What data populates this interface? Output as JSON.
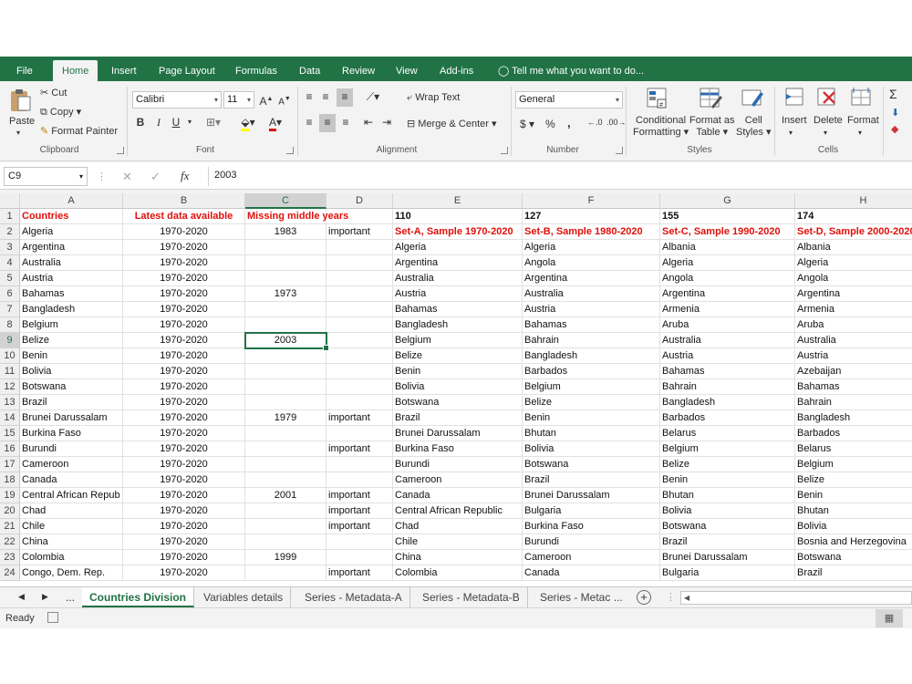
{
  "ribbon_tabs": [
    "File",
    "Home",
    "Insert",
    "Page Layout",
    "Formulas",
    "Data",
    "Review",
    "View",
    "Add-ins",
    "Tell me what you want to do..."
  ],
  "clipboard": {
    "paste": "Paste",
    "cut": "Cut",
    "copy": "Copy",
    "format_painter": "Format Painter",
    "label": "Clipboard"
  },
  "font": {
    "name": "Calibri",
    "size": "11",
    "bold": "B",
    "italic": "I",
    "underline": "U",
    "label": "Font"
  },
  "alignment": {
    "wrap_text": "Wrap Text",
    "merge_center": "Merge & Center",
    "label": "Alignment"
  },
  "number": {
    "format": "General",
    "currency": "$",
    "percent": "%",
    "comma": ",",
    "label": "Number"
  },
  "styles": {
    "conditional": "Conditional",
    "conditional2": "Formatting",
    "format_as": "Format as",
    "table": "Table",
    "cell": "Cell",
    "styles_btn": "Styles",
    "label": "Styles"
  },
  "cells": {
    "insert": "Insert",
    "delete": "Delete",
    "format": "Format",
    "label": "Cells"
  },
  "formula_bar": {
    "name_box": "C9",
    "value": "2003"
  },
  "columns": [
    "A",
    "B",
    "C",
    "D",
    "E",
    "F",
    "G",
    "H"
  ],
  "rows": [
    [
      "Countries",
      "Latest data available",
      "Missing middle years",
      "",
      "110",
      "127",
      "155",
      "174"
    ],
    [
      "Algeria",
      "1970-2020",
      "1983",
      "important",
      "Set-A, Sample 1970-2020",
      "Set-B, Sample 1980-2020",
      "Set-C, Sample 1990-2020",
      "Set-D, Sample 2000-2020"
    ],
    [
      "Argentina",
      "1970-2020",
      "",
      "",
      "Algeria",
      "Algeria",
      "Albania",
      "Albania"
    ],
    [
      "Australia",
      "1970-2020",
      "",
      "",
      "Argentina",
      "Angola",
      "Algeria",
      "Algeria"
    ],
    [
      "Austria",
      "1970-2020",
      "",
      "",
      "Australia",
      "Argentina",
      "Angola",
      "Angola"
    ],
    [
      "Bahamas",
      "1970-2020",
      "1973",
      "",
      "Austria",
      "Australia",
      "Argentina",
      "Argentina"
    ],
    [
      "Bangladesh",
      "1970-2020",
      "",
      "",
      "Bahamas",
      "Austria",
      "Armenia",
      "Armenia"
    ],
    [
      "Belgium",
      "1970-2020",
      "",
      "",
      "Bangladesh",
      "Bahamas",
      "Aruba",
      "Aruba"
    ],
    [
      "Belize",
      "1970-2020",
      "2003",
      "",
      "Belgium",
      "Bahrain",
      "Australia",
      "Australia"
    ],
    [
      "Benin",
      "1970-2020",
      "",
      "",
      "Belize",
      "Bangladesh",
      "Austria",
      "Austria"
    ],
    [
      "Bolivia",
      "1970-2020",
      "",
      "",
      "Benin",
      "Barbados",
      "Bahamas",
      "Azebaijan"
    ],
    [
      "Botswana",
      "1970-2020",
      "",
      "",
      "Bolivia",
      "Belgium",
      "Bahrain",
      "Bahamas"
    ],
    [
      "Brazil",
      "1970-2020",
      "",
      "",
      "Botswana",
      "Belize",
      "Bangladesh",
      "Bahrain"
    ],
    [
      "Brunei Darussalam",
      "1970-2020",
      "1979",
      "important",
      "Brazil",
      "Benin",
      "Barbados",
      "Bangladesh"
    ],
    [
      "Burkina Faso",
      "1970-2020",
      "",
      "",
      "Brunei Darussalam",
      "Bhutan",
      "Belarus",
      "Barbados"
    ],
    [
      "Burundi",
      "1970-2020",
      "",
      "important",
      "Burkina Faso",
      "Bolivia",
      "Belgium",
      "Belarus"
    ],
    [
      "Cameroon",
      "1970-2020",
      "",
      "",
      "Burundi",
      "Botswana",
      "Belize",
      "Belgium"
    ],
    [
      "Canada",
      "1970-2020",
      "",
      "",
      "Cameroon",
      "Brazil",
      "Benin",
      "Belize"
    ],
    [
      "Central African Repub",
      "1970-2020",
      "2001",
      "important",
      "Canada",
      "Brunei Darussalam",
      "Bhutan",
      "Benin"
    ],
    [
      "Chad",
      "1970-2020",
      "",
      "important",
      "Central African Republic",
      "Bulgaria",
      "Bolivia",
      "Bhutan"
    ],
    [
      "Chile",
      "1970-2020",
      "",
      "important",
      "Chad",
      "Burkina Faso",
      "Botswana",
      "Bolivia"
    ],
    [
      "China",
      "1970-2020",
      "",
      "",
      "Chile",
      "Burundi",
      "Brazil",
      "Bosnia and Herzegovina"
    ],
    [
      "Colombia",
      "1970-2020",
      "1999",
      "",
      "China",
      "Cameroon",
      "Brunei Darussalam",
      "Botswana"
    ],
    [
      "Congo, Dem. Rep.",
      "1970-2020",
      "",
      "important",
      "Colombia",
      "Canada",
      "Bulgaria",
      "Brazil"
    ]
  ],
  "sheet_tabs": [
    "Countries Division",
    "Variables details",
    "Series - Metadata-A",
    "Series - Metadata-B",
    "Series - Metac ..."
  ],
  "status": {
    "ready": "Ready"
  },
  "colors": {
    "accent": "#217346",
    "header_red": "#e0100a"
  }
}
